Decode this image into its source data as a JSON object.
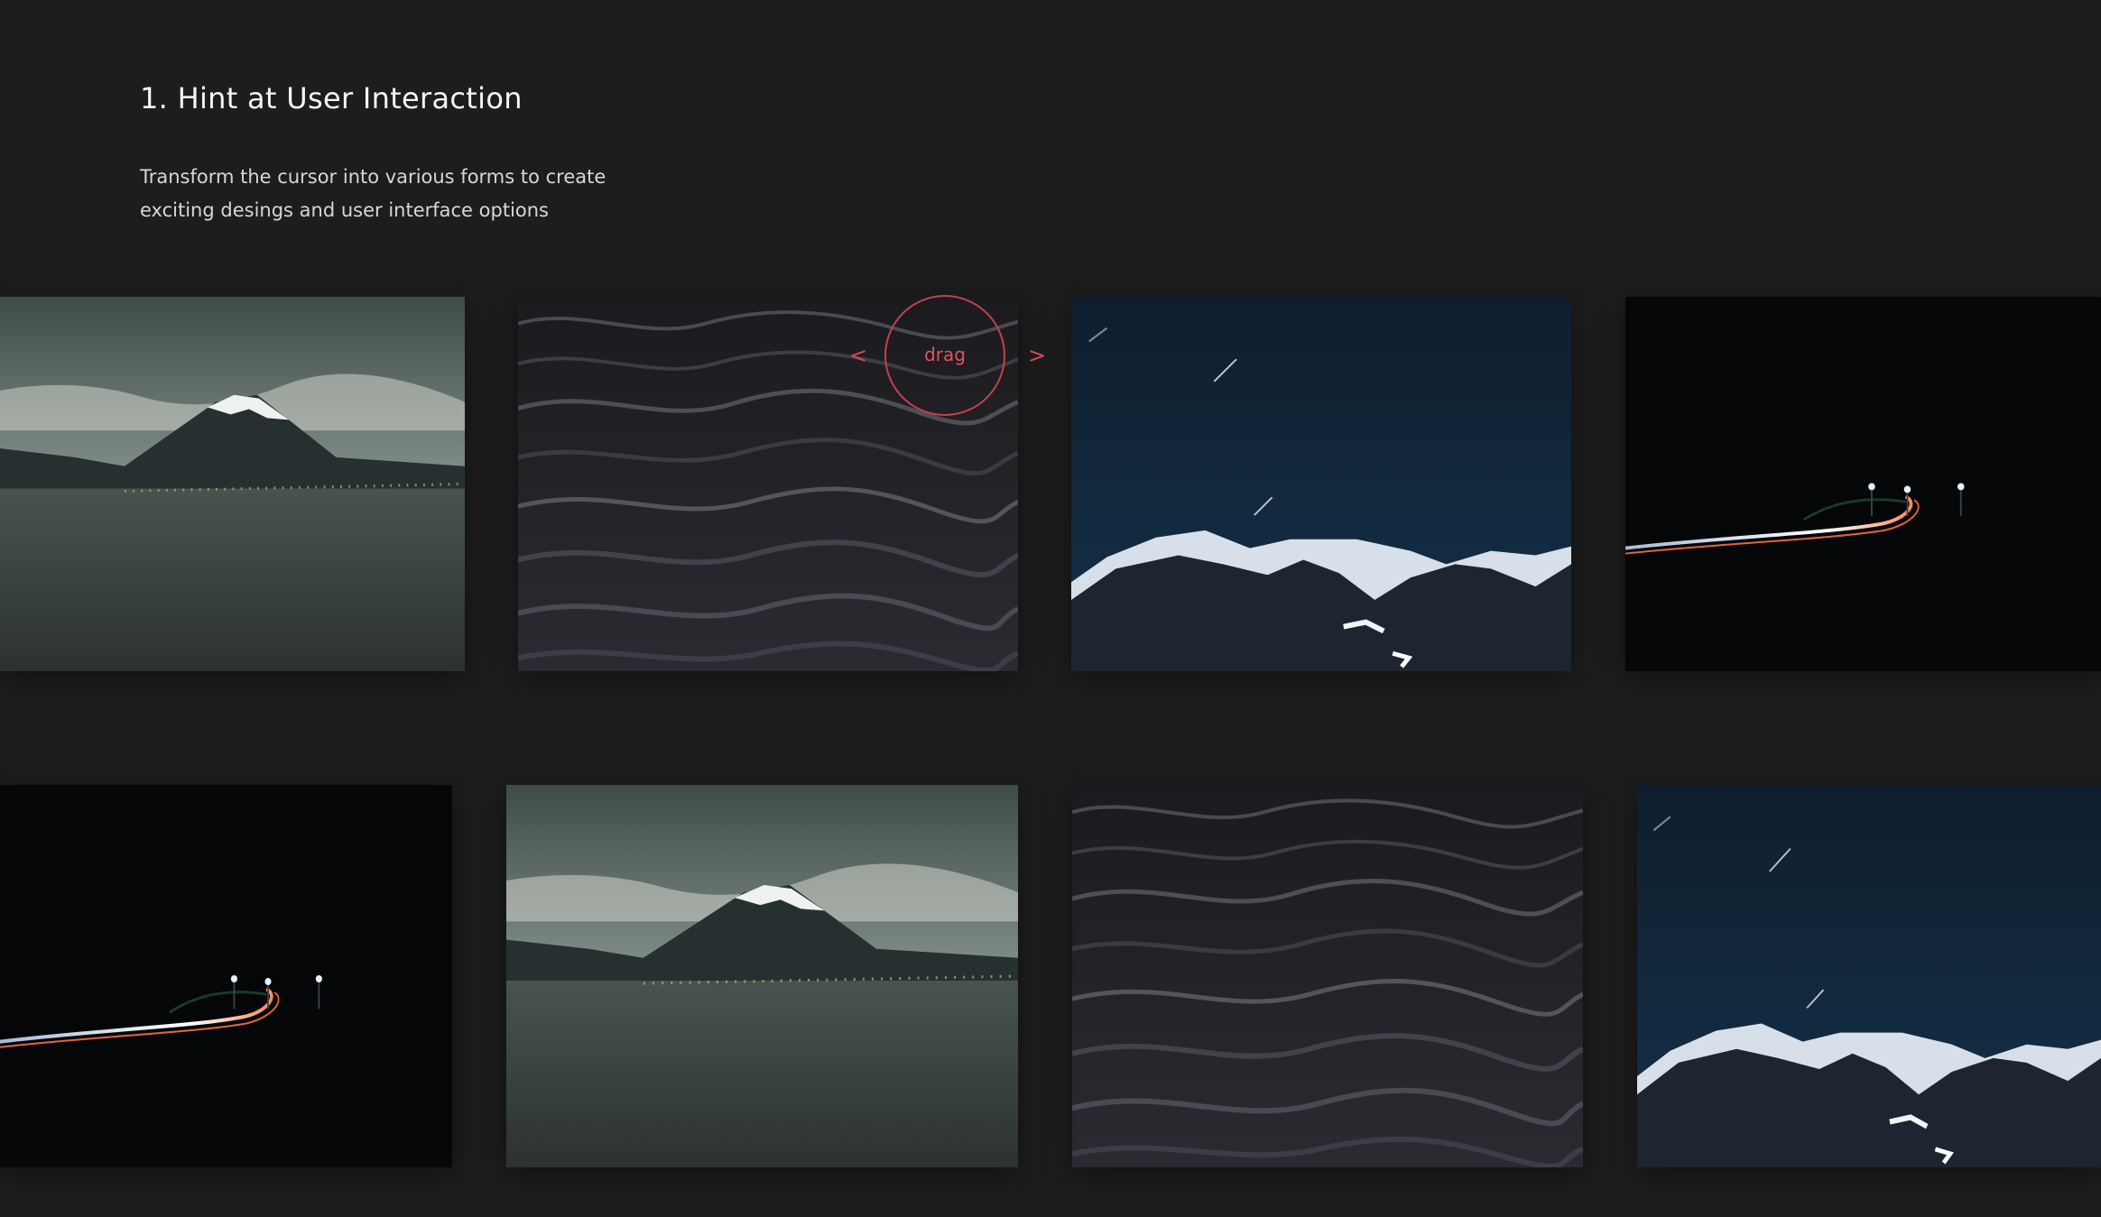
{
  "header": {
    "title": "1. Hint at User Interaction",
    "description_line1": "Transform the cursor into various forms to create",
    "description_line2": "exciting desings and user interface options"
  },
  "cursor": {
    "label": "drag",
    "left_arrow": "<",
    "right_arrow": ">",
    "accent_color": "#c4404b"
  },
  "gallery": {
    "row1": [
      "mount-fuji-lake-image",
      "dark-ocean-waves-image",
      "snowy-mountains-night-image",
      "night-road-light-trails-image"
    ],
    "row2": [
      "night-road-light-trails-image",
      "mount-fuji-lake-image",
      "dark-ocean-waves-image",
      "snowy-mountains-night-image"
    ]
  }
}
